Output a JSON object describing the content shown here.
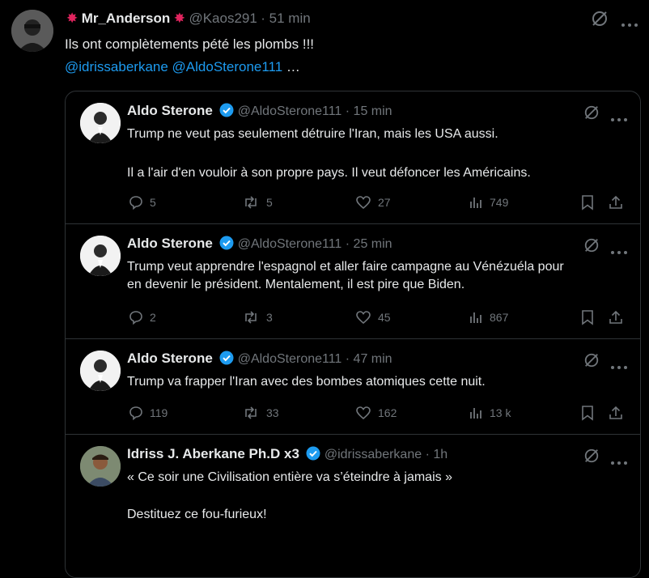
{
  "main_tweet": {
    "author_name": "Mr_Anderson",
    "author_handle": "@Kaos291",
    "time": "· 51 min",
    "text": "Ils ont complètements pété les plombs !!!",
    "mentions": "@idrissaberkane @AldoSterone111",
    "ellipsis": " …"
  },
  "quoted_tweets": [
    {
      "author_name": "Aldo Sterone",
      "author_handle": "@AldoSterone111",
      "time": "· 15 min",
      "line1": "Trump ne veut pas seulement détruire l'Iran, mais les USA aussi.",
      "line2": "Il a l'air d'en vouloir à son propre pays. Il veut défoncer les Américains.",
      "replies": "5",
      "reposts": "5",
      "likes": "27",
      "views": "749"
    },
    {
      "author_name": "Aldo Sterone",
      "author_handle": "@AldoSterone111",
      "time": "· 25 min",
      "line1": "Trump veut apprendre l'espagnol et aller faire campagne au Vénézuéla pour",
      "line2": "en devenir le président. Mentalement, il est pire que Biden.",
      "replies": "2",
      "reposts": "3",
      "likes": "45",
      "views": "867"
    },
    {
      "author_name": "Aldo Sterone",
      "author_handle": "@AldoSterone111",
      "time": "· 47 min",
      "line1": "Trump va frapper l'Iran avec des bombes atomiques cette nuit.",
      "line2": "",
      "replies": "119",
      "reposts": "33",
      "likes": "162",
      "views": "13 k"
    },
    {
      "author_name": "Idriss J. Aberkane Ph.D x3",
      "author_handle": "@idrissaberkane",
      "time": "· 1h",
      "line1": "« Ce soir une Civilisation entière va s’éteindre à jamais »",
      "line2": "Destituez ce fou-furieux!"
    }
  ],
  "colors": {
    "background": "#000000",
    "text": "#e7e9ea",
    "muted": "#71767b",
    "link": "#1d9bf0",
    "border": "#2f3336",
    "verified": "#1d9bf0"
  }
}
